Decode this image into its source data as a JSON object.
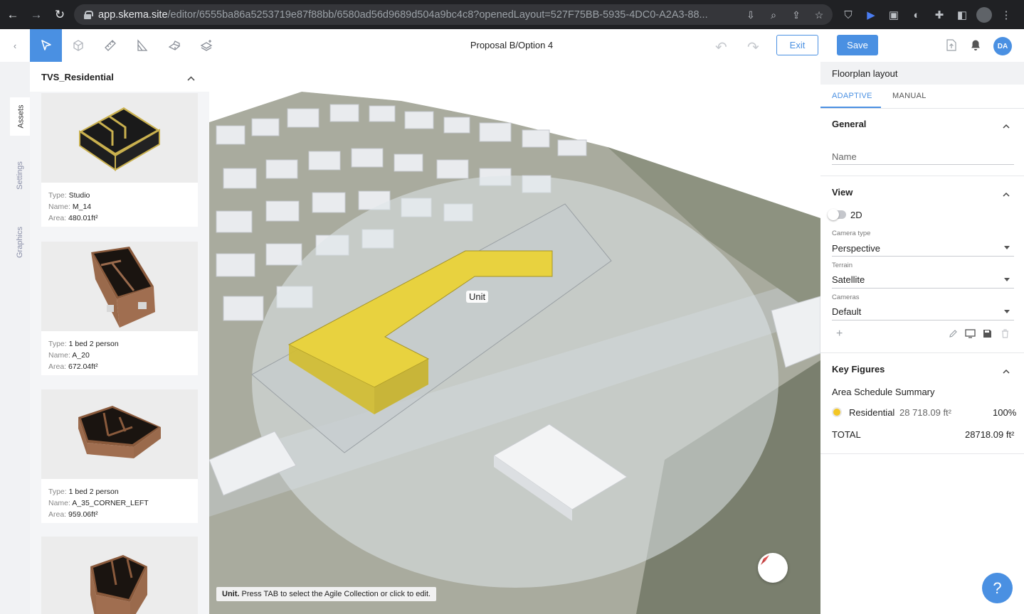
{
  "browser": {
    "url_host": "app.skema.site",
    "url_path": "/editor/6555ba86a5253719e87f88bb/6580ad56d9689d504a9bc4c8?openedLayout=527F75BB-5935-4DC0-A2A3-88..."
  },
  "toolbar": {
    "title": "Proposal B/Option 4",
    "exit_label": "Exit",
    "save_label": "Save",
    "avatar_initials": "DA"
  },
  "vertical_tabs": [
    "Assets",
    "Settings",
    "Graphics"
  ],
  "assets": {
    "header": "TVS_Residential",
    "field_labels": {
      "type": "Type:",
      "name": "Name:",
      "area": "Area:"
    },
    "items": [
      {
        "type": "Studio",
        "name": "M_14",
        "area": "480.01ft²"
      },
      {
        "type": "1 bed 2 person",
        "name": "A_20",
        "area": "672.04ft²"
      },
      {
        "type": "1 bed 2 person",
        "name": "A_35_CORNER_LEFT",
        "area": "959.06ft²"
      }
    ]
  },
  "viewport": {
    "unit_label": "Unit",
    "tip_bold": "Unit.",
    "tip_text": " Press TAB to select the Agile Collection or click to edit."
  },
  "right_panel": {
    "title": "Floorplan layout",
    "tabs": [
      "ADAPTIVE",
      "MANUAL"
    ],
    "general": {
      "heading": "General",
      "name_placeholder": "Name"
    },
    "view": {
      "heading": "View",
      "toggle_label": "2D",
      "camera_type_label": "Camera type",
      "camera_type_value": "Perspective",
      "terrain_label": "Terrain",
      "terrain_value": "Satellite",
      "cameras_label": "Cameras",
      "cameras_value": "Default",
      "add_symbol": "+"
    },
    "key_figures": {
      "heading": "Key Figures",
      "summary_title": "Area Schedule Summary",
      "row_name": "Residential",
      "row_area": "28 718.09 ft²",
      "row_percent": "100%",
      "total_label": "TOTAL",
      "total_value": "28718.09 ft²"
    }
  },
  "help_symbol": "?",
  "colors": {
    "accent": "#4a90e2",
    "unit_yellow": "#e9d23c"
  }
}
